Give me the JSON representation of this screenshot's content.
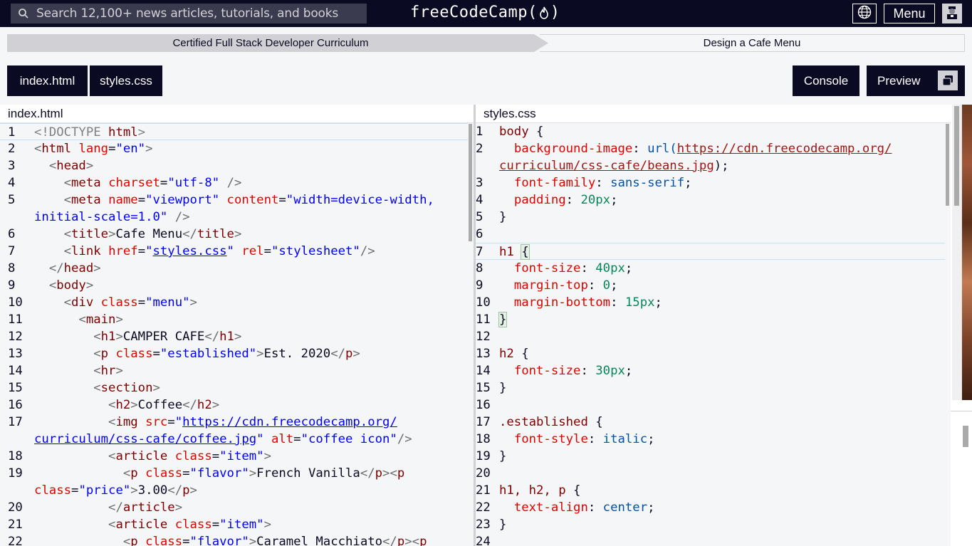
{
  "nav": {
    "search_placeholder": "Search 12,100+ news articles, tutorials, and books",
    "logo_text_left": "freeCodeCamp(",
    "logo_text_right": ")",
    "menu_label": "Menu"
  },
  "breadcrumb": {
    "curriculum": "Certified Full Stack Developer Curriculum",
    "project": "Design a Cafe Menu"
  },
  "tabs": {
    "index": "index.html",
    "styles": "styles.css",
    "console": "Console",
    "preview": "Preview"
  },
  "editors": {
    "left_title": "index.html",
    "right_title": "styles.css"
  },
  "html_lines": [
    {
      "n": "1",
      "segments": [
        [
          "dt",
          "<!DOCTYPE "
        ],
        [
          "tag",
          "html"
        ],
        [
          "dt",
          ">"
        ]
      ]
    },
    {
      "n": "2",
      "segments": [
        [
          "ang",
          "<"
        ],
        [
          "tag",
          "html"
        ],
        [
          "punct",
          " "
        ],
        [
          "attr",
          "lang"
        ],
        [
          "punct",
          "="
        ],
        [
          "val",
          "\"en\""
        ],
        [
          "ang",
          ">"
        ]
      ]
    },
    {
      "n": "3",
      "segments": [
        [
          "punct",
          "  "
        ],
        [
          "ang",
          "<"
        ],
        [
          "tag",
          "head"
        ],
        [
          "ang",
          ">"
        ]
      ]
    },
    {
      "n": "4",
      "segments": [
        [
          "punct",
          "    "
        ],
        [
          "ang",
          "<"
        ],
        [
          "tag",
          "meta"
        ],
        [
          "punct",
          " "
        ],
        [
          "attr",
          "charset"
        ],
        [
          "punct",
          "="
        ],
        [
          "val",
          "\"utf-8\""
        ],
        [
          "punct",
          " "
        ],
        [
          "ang",
          "/>"
        ]
      ]
    },
    {
      "n": "5",
      "segments": [
        [
          "punct",
          "    "
        ],
        [
          "ang",
          "<"
        ],
        [
          "tag",
          "meta"
        ],
        [
          "punct",
          " "
        ],
        [
          "attr",
          "name"
        ],
        [
          "punct",
          "="
        ],
        [
          "val",
          "\"viewport\""
        ],
        [
          "punct",
          " "
        ],
        [
          "attr",
          "content"
        ],
        [
          "punct",
          "="
        ],
        [
          "val",
          "\"width=device-width,"
        ]
      ]
    },
    {
      "n": "",
      "segments": [
        [
          "val",
          "initial-scale=1.0\""
        ],
        [
          "punct",
          " "
        ],
        [
          "ang",
          "/>"
        ]
      ]
    },
    {
      "n": "6",
      "segments": [
        [
          "punct",
          "    "
        ],
        [
          "ang",
          "<"
        ],
        [
          "tag",
          "title"
        ],
        [
          "ang",
          ">"
        ],
        [
          "punct",
          "Cafe Menu"
        ],
        [
          "ang",
          "</"
        ],
        [
          "tag",
          "title"
        ],
        [
          "ang",
          ">"
        ]
      ]
    },
    {
      "n": "7",
      "segments": [
        [
          "punct",
          "    "
        ],
        [
          "ang",
          "<"
        ],
        [
          "tag",
          "link"
        ],
        [
          "punct",
          " "
        ],
        [
          "attr",
          "href"
        ],
        [
          "punct",
          "="
        ],
        [
          "val",
          "\""
        ],
        [
          "url",
          "styles.css"
        ],
        [
          "val",
          "\""
        ],
        [
          "punct",
          " "
        ],
        [
          "attr",
          "rel"
        ],
        [
          "punct",
          "="
        ],
        [
          "val",
          "\"stylesheet\""
        ],
        [
          "ang",
          "/>"
        ]
      ]
    },
    {
      "n": "8",
      "segments": [
        [
          "punct",
          "  "
        ],
        [
          "ang",
          "</"
        ],
        [
          "tag",
          "head"
        ],
        [
          "ang",
          ">"
        ]
      ]
    },
    {
      "n": "9",
      "segments": [
        [
          "punct",
          "  "
        ],
        [
          "ang",
          "<"
        ],
        [
          "tag",
          "body"
        ],
        [
          "ang",
          ">"
        ]
      ]
    },
    {
      "n": "10",
      "segments": [
        [
          "punct",
          "    "
        ],
        [
          "ang",
          "<"
        ],
        [
          "tag",
          "div"
        ],
        [
          "punct",
          " "
        ],
        [
          "attr",
          "class"
        ],
        [
          "punct",
          "="
        ],
        [
          "val",
          "\"menu\""
        ],
        [
          "ang",
          ">"
        ]
      ]
    },
    {
      "n": "11",
      "segments": [
        [
          "punct",
          "      "
        ],
        [
          "ang",
          "<"
        ],
        [
          "tag",
          "main"
        ],
        [
          "ang",
          ">"
        ]
      ]
    },
    {
      "n": "12",
      "segments": [
        [
          "punct",
          "        "
        ],
        [
          "ang",
          "<"
        ],
        [
          "tag",
          "h1"
        ],
        [
          "ang",
          ">"
        ],
        [
          "punct",
          "CAMPER CAFE"
        ],
        [
          "ang",
          "</"
        ],
        [
          "tag",
          "h1"
        ],
        [
          "ang",
          ">"
        ]
      ]
    },
    {
      "n": "13",
      "segments": [
        [
          "punct",
          "        "
        ],
        [
          "ang",
          "<"
        ],
        [
          "tag",
          "p"
        ],
        [
          "punct",
          " "
        ],
        [
          "attr",
          "class"
        ],
        [
          "punct",
          "="
        ],
        [
          "val",
          "\"established\""
        ],
        [
          "ang",
          ">"
        ],
        [
          "punct",
          "Est. 2020"
        ],
        [
          "ang",
          "</"
        ],
        [
          "tag",
          "p"
        ],
        [
          "ang",
          ">"
        ]
      ]
    },
    {
      "n": "14",
      "segments": [
        [
          "punct",
          "        "
        ],
        [
          "ang",
          "<"
        ],
        [
          "tag",
          "hr"
        ],
        [
          "ang",
          ">"
        ]
      ]
    },
    {
      "n": "15",
      "segments": [
        [
          "punct",
          "        "
        ],
        [
          "ang",
          "<"
        ],
        [
          "tag",
          "section"
        ],
        [
          "ang",
          ">"
        ]
      ]
    },
    {
      "n": "16",
      "segments": [
        [
          "punct",
          "          "
        ],
        [
          "ang",
          "<"
        ],
        [
          "tag",
          "h2"
        ],
        [
          "ang",
          ">"
        ],
        [
          "punct",
          "Coffee"
        ],
        [
          "ang",
          "</"
        ],
        [
          "tag",
          "h2"
        ],
        [
          "ang",
          ">"
        ]
      ]
    },
    {
      "n": "17",
      "segments": [
        [
          "punct",
          "          "
        ],
        [
          "ang",
          "<"
        ],
        [
          "tag",
          "img"
        ],
        [
          "punct",
          " "
        ],
        [
          "attr",
          "src"
        ],
        [
          "punct",
          "="
        ],
        [
          "val",
          "\""
        ],
        [
          "url",
          "https://cdn.freecodecamp.org/"
        ]
      ]
    },
    {
      "n": "",
      "segments": [
        [
          "url",
          "curriculum/css-cafe/coffee.jpg"
        ],
        [
          "val",
          "\""
        ],
        [
          "punct",
          " "
        ],
        [
          "attr",
          "alt"
        ],
        [
          "punct",
          "="
        ],
        [
          "val",
          "\"coffee icon\""
        ],
        [
          "ang",
          "/>"
        ]
      ]
    },
    {
      "n": "18",
      "segments": [
        [
          "punct",
          "          "
        ],
        [
          "ang",
          "<"
        ],
        [
          "tag",
          "article"
        ],
        [
          "punct",
          " "
        ],
        [
          "attr",
          "class"
        ],
        [
          "punct",
          "="
        ],
        [
          "val",
          "\"item\""
        ],
        [
          "ang",
          ">"
        ]
      ]
    },
    {
      "n": "19",
      "segments": [
        [
          "punct",
          "            "
        ],
        [
          "ang",
          "<"
        ],
        [
          "tag",
          "p"
        ],
        [
          "punct",
          " "
        ],
        [
          "attr",
          "class"
        ],
        [
          "punct",
          "="
        ],
        [
          "val",
          "\"flavor\""
        ],
        [
          "ang",
          ">"
        ],
        [
          "punct",
          "French Vanilla"
        ],
        [
          "ang",
          "</"
        ],
        [
          "tag",
          "p"
        ],
        [
          "ang",
          "><"
        ],
        [
          "tag",
          "p"
        ]
      ]
    },
    {
      "n": "",
      "segments": [
        [
          "attr",
          "class"
        ],
        [
          "punct",
          "="
        ],
        [
          "val",
          "\"price\""
        ],
        [
          "ang",
          ">"
        ],
        [
          "punct",
          "3.00"
        ],
        [
          "ang",
          "</"
        ],
        [
          "tag",
          "p"
        ],
        [
          "ang",
          ">"
        ]
      ]
    },
    {
      "n": "20",
      "segments": [
        [
          "punct",
          "          "
        ],
        [
          "ang",
          "</"
        ],
        [
          "tag",
          "article"
        ],
        [
          "ang",
          ">"
        ]
      ]
    },
    {
      "n": "21",
      "segments": [
        [
          "punct",
          "          "
        ],
        [
          "ang",
          "<"
        ],
        [
          "tag",
          "article"
        ],
        [
          "punct",
          " "
        ],
        [
          "attr",
          "class"
        ],
        [
          "punct",
          "="
        ],
        [
          "val",
          "\"item\""
        ],
        [
          "ang",
          ">"
        ]
      ]
    },
    {
      "n": "22",
      "segments": [
        [
          "punct",
          "            "
        ],
        [
          "ang",
          "<"
        ],
        [
          "tag",
          "p"
        ],
        [
          "punct",
          " "
        ],
        [
          "attr",
          "class"
        ],
        [
          "punct",
          "="
        ],
        [
          "val",
          "\"flavor\""
        ],
        [
          "ang",
          ">"
        ],
        [
          "punct",
          "Caramel Macchiato"
        ],
        [
          "ang",
          "</"
        ],
        [
          "tag",
          "p"
        ],
        [
          "ang",
          "><"
        ],
        [
          "tag",
          "p"
        ]
      ]
    }
  ],
  "css_lines": [
    {
      "n": "1",
      "segments": [
        [
          "sel",
          "body"
        ],
        [
          "punct",
          " {"
        ]
      ]
    },
    {
      "n": "2",
      "segments": [
        [
          "punct",
          "  "
        ],
        [
          "prop",
          "background-image"
        ],
        [
          "punct",
          ": "
        ],
        [
          "cval",
          "url("
        ],
        [
          "curl",
          "https://cdn.freecodecamp.org/"
        ]
      ]
    },
    {
      "n": "",
      "segments": [
        [
          "curl",
          "curriculum/css-cafe/beans.jpg"
        ],
        [
          "punct",
          ");"
        ]
      ]
    },
    {
      "n": "3",
      "segments": [
        [
          "punct",
          "  "
        ],
        [
          "prop",
          "font-family"
        ],
        [
          "punct",
          ": "
        ],
        [
          "cval",
          "sans-serif"
        ],
        [
          "punct",
          ";"
        ]
      ]
    },
    {
      "n": "4",
      "segments": [
        [
          "punct",
          "  "
        ],
        [
          "prop",
          "padding"
        ],
        [
          "punct",
          ": "
        ],
        [
          "num",
          "20px"
        ],
        [
          "punct",
          ";"
        ]
      ]
    },
    {
      "n": "5",
      "segments": [
        [
          "punct",
          "}"
        ]
      ]
    },
    {
      "n": "6",
      "segments": []
    },
    {
      "n": "7",
      "segments": [
        [
          "sel",
          "h1"
        ],
        [
          "punct",
          " "
        ],
        [
          "bracket-hl",
          "{"
        ]
      ]
    },
    {
      "n": "8",
      "segments": [
        [
          "punct",
          "  "
        ],
        [
          "prop",
          "font-size"
        ],
        [
          "punct",
          ": "
        ],
        [
          "num",
          "40px"
        ],
        [
          "punct",
          ";"
        ]
      ]
    },
    {
      "n": "9",
      "segments": [
        [
          "punct",
          "  "
        ],
        [
          "prop",
          "margin-top"
        ],
        [
          "punct",
          ": "
        ],
        [
          "num",
          "0"
        ],
        [
          "punct",
          ";"
        ]
      ]
    },
    {
      "n": "10",
      "segments": [
        [
          "punct",
          "  "
        ],
        [
          "prop",
          "margin-bottom"
        ],
        [
          "punct",
          ": "
        ],
        [
          "num",
          "15px"
        ],
        [
          "punct",
          ";"
        ]
      ]
    },
    {
      "n": "11",
      "segments": [
        [
          "bracket-hl",
          "}"
        ]
      ]
    },
    {
      "n": "12",
      "segments": []
    },
    {
      "n": "13",
      "segments": [
        [
          "sel",
          "h2"
        ],
        [
          "punct",
          " {"
        ]
      ]
    },
    {
      "n": "14",
      "segments": [
        [
          "punct",
          "  "
        ],
        [
          "prop",
          "font-size"
        ],
        [
          "punct",
          ": "
        ],
        [
          "num",
          "30px"
        ],
        [
          "punct",
          ";"
        ]
      ]
    },
    {
      "n": "15",
      "segments": [
        [
          "punct",
          "}"
        ]
      ]
    },
    {
      "n": "16",
      "segments": []
    },
    {
      "n": "17",
      "segments": [
        [
          "sel",
          ".established"
        ],
        [
          "punct",
          " {"
        ]
      ]
    },
    {
      "n": "18",
      "segments": [
        [
          "punct",
          "  "
        ],
        [
          "prop",
          "font-style"
        ],
        [
          "punct",
          ": "
        ],
        [
          "cval",
          "italic"
        ],
        [
          "punct",
          ";"
        ]
      ]
    },
    {
      "n": "19",
      "segments": [
        [
          "punct",
          "}"
        ]
      ]
    },
    {
      "n": "20",
      "segments": []
    },
    {
      "n": "21",
      "segments": [
        [
          "sel",
          "h1, h2, p"
        ],
        [
          "punct",
          " {"
        ]
      ]
    },
    {
      "n": "22",
      "segments": [
        [
          "punct",
          "  "
        ],
        [
          "prop",
          "text-align"
        ],
        [
          "punct",
          ": "
        ],
        [
          "cval",
          "center"
        ],
        [
          "punct",
          ";"
        ]
      ]
    },
    {
      "n": "23",
      "segments": [
        [
          "punct",
          "}"
        ]
      ]
    },
    {
      "n": "24",
      "segments": []
    }
  ],
  "colors": {
    "nav_bg": "#0a0a23",
    "crumb_bg": "#d0d0d5",
    "editor_bg": "#f5f6f7"
  }
}
